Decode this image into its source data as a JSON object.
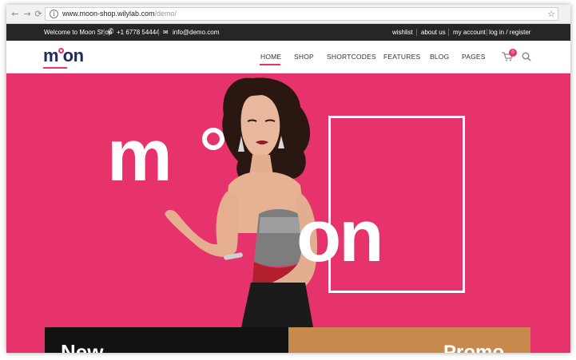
{
  "browser": {
    "back": "←",
    "forward": "→",
    "reload": "⟳",
    "url_host": "www.moon-shop.wilylab.com",
    "url_path": "/demo/",
    "info_icon": "i",
    "star": "☆"
  },
  "topbar": {
    "welcome": "Welcome to Moon Shop",
    "phone": "+1 6778 54444",
    "email": "info@demo.com",
    "links": [
      "wishlist",
      "about us",
      "my account",
      "log in / register"
    ]
  },
  "nav": {
    "logo": "m on",
    "items": [
      "HOME",
      "SHOP",
      "SHORTCODES",
      "FEATURES",
      "BLOG",
      "PAGES"
    ],
    "active": "HOME",
    "cart_count": "0"
  },
  "hero": {
    "word_left": "m",
    "word_right": "on"
  },
  "banners": {
    "new_label": "New",
    "promo_label": "Promo"
  },
  "colors": {
    "accent": "#e6336b",
    "topbar": "#262626",
    "logo": "#1e2a5c"
  }
}
